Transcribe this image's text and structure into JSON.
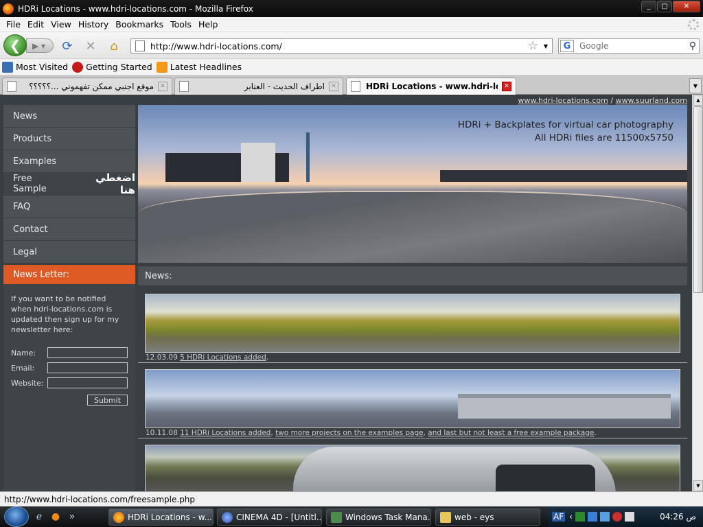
{
  "window": {
    "title": "HDRi Locations - www.hdri-locations.com - Mozilla Firefox",
    "min": "_",
    "max": "▢",
    "close": "✕"
  },
  "menu": [
    "File",
    "Edit",
    "View",
    "History",
    "Bookmarks",
    "Tools",
    "Help"
  ],
  "nav": {
    "url": "http://www.hdri-locations.com/",
    "search_placeholder": "Google"
  },
  "bookmarks": [
    "Most Visited",
    "Getting Started",
    "Latest Headlines"
  ],
  "tabs": [
    {
      "label": "موقع اجنبي ممكن تفهموني ...؟؟؟؟؟",
      "active": false
    },
    {
      "label": "اطراف الحديث - العنابر",
      "active": false
    },
    {
      "label": "HDRi Locations - www.hdri-locati...",
      "active": true
    }
  ],
  "site": {
    "toplinks": [
      "www.hdri-locations.com",
      "/",
      "www.suurland.com"
    ],
    "menu": [
      "News",
      "Products",
      "Examples",
      "Free Sample",
      "FAQ",
      "Contact",
      "Legal"
    ],
    "free_sample_note": "اضغطي هنا",
    "banner_line1": "HDRi + Backplates for virtual car photography",
    "banner_line2": "All HDRi files are 11500x5750",
    "newsletter_title": "News Letter:",
    "newsletter_text": "If you want to be notified when hdri-locations.com is updated then sign up for my newsletter here:",
    "fields": [
      "Name:",
      "Email:",
      "Website:"
    ],
    "submit": "Submit",
    "news_title": "News:",
    "news": [
      {
        "date": "12.03.09",
        "links": [
          "5 HDRi Locations added"
        ],
        "tail": "."
      },
      {
        "date": "10.11.08",
        "links": [
          "11 HDRi Locations added",
          "two more projects on the examples page",
          "and last but not least a free example package"
        ],
        "tail": "."
      }
    ]
  },
  "status": "http://www.hdri-locations.com/freesample.php",
  "taskbar": {
    "tasks": [
      "HDRi Locations - w...",
      "CINEMA 4D - [Untitl...",
      "Windows Task Mana...",
      "web - eys"
    ],
    "tray_lang": "AF",
    "clock": "04:26 ص"
  }
}
